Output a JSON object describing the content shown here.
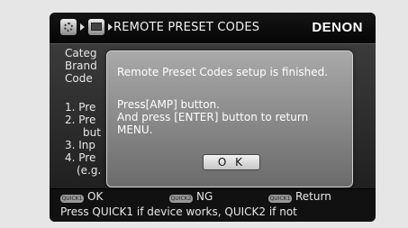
{
  "header": {
    "title": "REMOTE PRESET CODES",
    "brand": "DENON",
    "icons": [
      "gear-icon",
      "tv-icon"
    ]
  },
  "body_lines": [
    "Categ",
    "Brand",
    "Code",
    "1. Pre",
    "2. Pre",
    "but",
    "3. Inp",
    "4. Pre",
    "(e.g."
  ],
  "dialog": {
    "message": "Remote Preset Codes setup is finished.",
    "line1": "Press[AMP] button.",
    "line2": "And press [ENTER] button to return",
    "line3": "MENU.",
    "ok_label": "O K"
  },
  "footer": {
    "quick1_badge": "QUICK1",
    "quick2_badge": "QUICK2",
    "quick1_label": "OK",
    "quick2_label": "NG",
    "return_label": "Return",
    "hint": "Press QUICK1 if device works, QUICK2 if not"
  }
}
